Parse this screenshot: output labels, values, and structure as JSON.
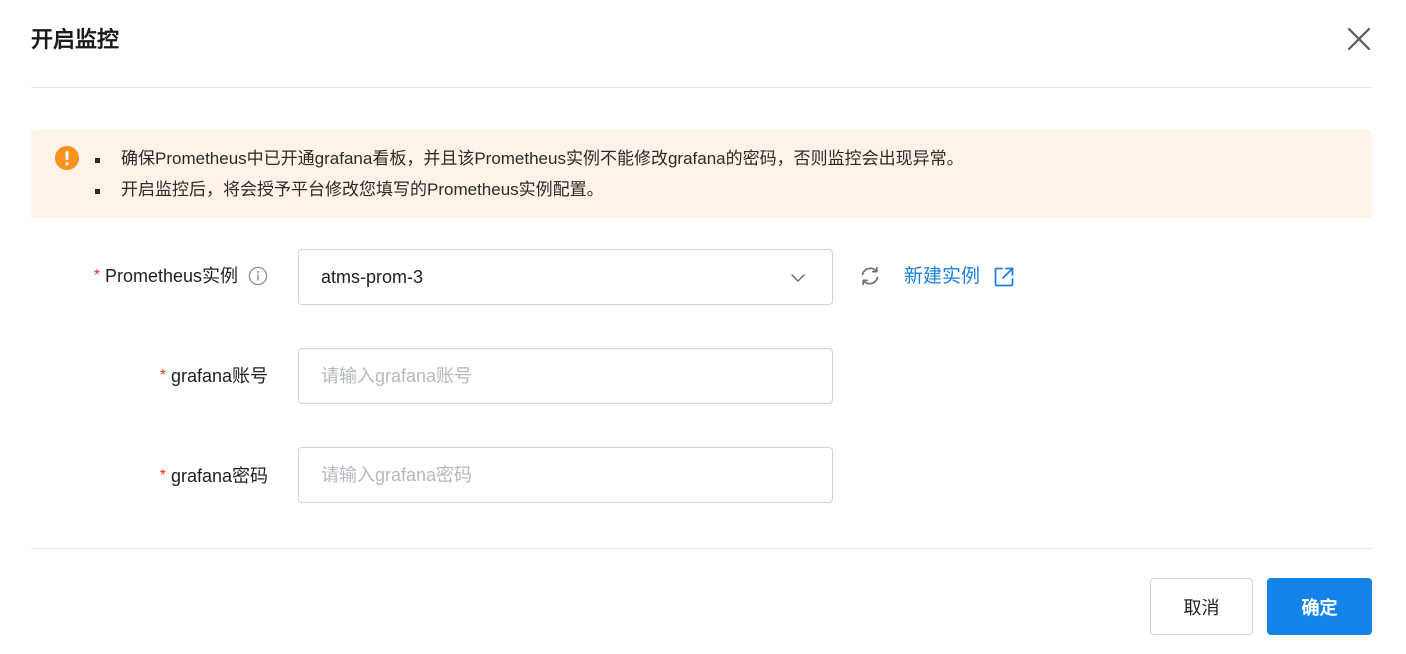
{
  "dialog": {
    "title": "开启监控"
  },
  "alert": {
    "items": [
      "确保Prometheus中已开通grafana看板，并且该Prometheus实例不能修改grafana的密码，否则监控会出现异常。",
      "开启监控后，将会授予平台修改您填写的Prometheus实例配置。"
    ],
    "color": "#f7931e",
    "background": "#fff3e8"
  },
  "form": {
    "instance": {
      "required_mark": "*",
      "label": "Prometheus实例",
      "value": "atms-prom-3",
      "new_link": "新建实例"
    },
    "account": {
      "required_mark": "*",
      "label": "grafana账号",
      "value": "",
      "placeholder": "请输入grafana账号"
    },
    "password": {
      "required_mark": "*",
      "label": "grafana密码",
      "value": "",
      "placeholder": "请输入grafana密码"
    }
  },
  "footer": {
    "cancel_label": "取消",
    "ok_label": "确定"
  },
  "colors": {
    "primary": "#1383e9",
    "link": "#1a7fe6",
    "required": "#e5322d"
  }
}
